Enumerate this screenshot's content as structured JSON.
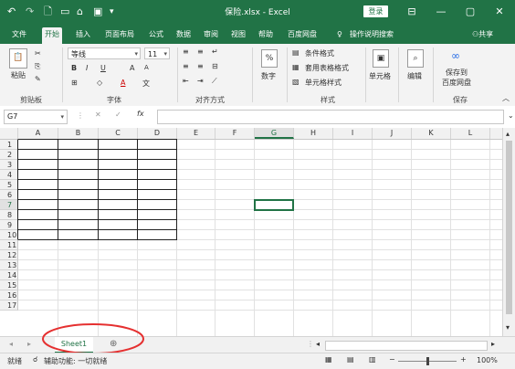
{
  "titlebar": {
    "title": "保险.xlsx - Excel",
    "login": "登录",
    "window_controls": {
      "minimize": "—",
      "maximize": "▢",
      "close": "✕"
    },
    "accent": "#217346"
  },
  "tabs": [
    "文件",
    "开始",
    "插入",
    "页面布局",
    "公式",
    "数据",
    "审阅",
    "视图",
    "帮助",
    "百度网盘",
    "操作说明搜索"
  ],
  "active_tab": "开始",
  "share": "共享",
  "ribbon": {
    "clipboard": {
      "paste": "粘贴",
      "label": "剪贴板"
    },
    "font": {
      "name": "等线",
      "size": "11",
      "bold": "B",
      "italic": "I",
      "underline": "U",
      "grow": "A",
      "shrink": "A",
      "label": "字体",
      "wen": "文"
    },
    "alignment": {
      "label": "对齐方式"
    },
    "number": {
      "btn": "数字",
      "pct": "%"
    },
    "styles": {
      "conditional": "条件格式",
      "table": "套用表格格式",
      "cell": "单元格样式",
      "label": "样式"
    },
    "cells": {
      "btn": "单元格"
    },
    "edit": {
      "btn": "编辑"
    },
    "save": {
      "line1": "保存到",
      "line2": "百度网盘",
      "label": "保存"
    }
  },
  "formula_bar": {
    "namebox": "G7",
    "fx": "fx",
    "value": ""
  },
  "columns": [
    "A",
    "B",
    "C",
    "D",
    "E",
    "F",
    "G",
    "H",
    "I",
    "J",
    "K",
    "L"
  ],
  "rows": [
    "1",
    "2",
    "3",
    "4",
    "5",
    "6",
    "7",
    "8",
    "9",
    "10",
    "11",
    "12",
    "13",
    "14",
    "15",
    "16",
    "17"
  ],
  "selected": {
    "col": "G",
    "row": "7"
  },
  "sheets": [
    "Sheet1"
  ],
  "status": {
    "ready": "就绪",
    "accessibility": "辅助功能: 一切就绪",
    "zoom": "100%"
  }
}
